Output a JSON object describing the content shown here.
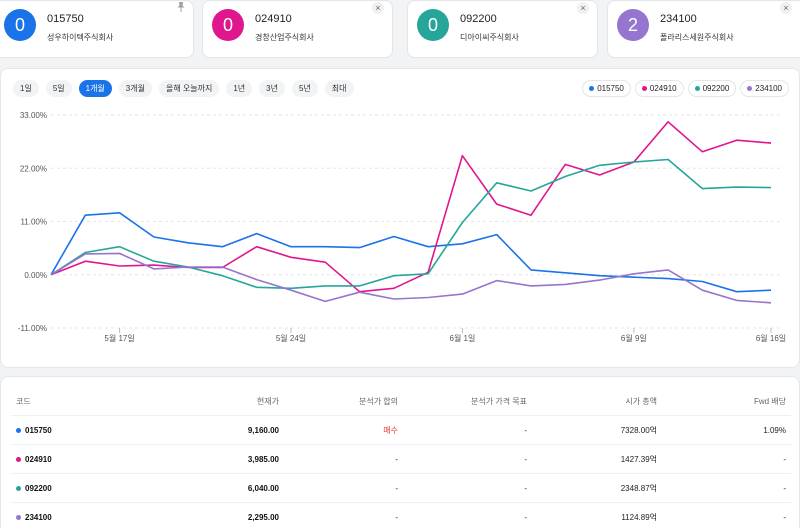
{
  "stocks": [
    {
      "index": "0",
      "code": "015750",
      "name": "성우하이텍주식회사",
      "color": "#1a73e8",
      "corner_icon": "pin-icon"
    },
    {
      "index": "0",
      "code": "024910",
      "name": "경창산업주식회사",
      "color": "#e0168f",
      "corner_icon": "close-icon"
    },
    {
      "index": "0",
      "code": "092200",
      "name": "디아이씨주식회사",
      "color": "#26a69a",
      "corner_icon": "close-icon"
    },
    {
      "index": "2",
      "code": "234100",
      "name": "폴라리스세원주식회사",
      "color": "#9575cd",
      "corner_icon": "close-icon"
    }
  ],
  "close_glyph": "×",
  "ranges": [
    "1일",
    "5일",
    "1개월",
    "3개월",
    "올해 오늘까지",
    "1년",
    "3년",
    "5년",
    "최대"
  ],
  "active_range": "1개월",
  "chart_data": {
    "type": "line",
    "y_ticks": [
      "33.00%",
      "22.00%",
      "11.00%",
      "0.00%",
      "-11.00%"
    ],
    "ylim": [
      -11,
      33
    ],
    "x_ticks": [
      {
        "label": "5월 17일",
        "index": 2
      },
      {
        "label": "5월 24일",
        "index": 7
      },
      {
        "label": "6월 1일",
        "index": 12
      },
      {
        "label": "6월 9일",
        "index": 17
      },
      {
        "label": "6월 16일",
        "index": 21
      }
    ],
    "n_points": 22,
    "series": [
      {
        "name": "015750",
        "color": "#1a73e8",
        "values": [
          0,
          12.3,
          12.8,
          7.8,
          6.6,
          5.8,
          8.5,
          5.8,
          5.8,
          5.6,
          7.9,
          5.8,
          6.4,
          8.3,
          1.0,
          0.4,
          -0.2,
          -0.5,
          -0.8,
          -1.4,
          -3.5,
          -3.2
        ]
      },
      {
        "name": "024910",
        "color": "#e0168f",
        "values": [
          0,
          2.8,
          1.8,
          2.0,
          1.5,
          1.5,
          5.8,
          3.6,
          2.6,
          -3.5,
          -2.8,
          0.5,
          24.6,
          14.6,
          12.3,
          22.8,
          20.6,
          23.3,
          31.6,
          25.4,
          27.8,
          27.2
        ]
      },
      {
        "name": "092200",
        "color": "#26a69a",
        "values": [
          0,
          4.6,
          5.8,
          2.8,
          1.6,
          -0.2,
          -2.6,
          -2.8,
          -2.3,
          -2.3,
          -0.2,
          0.2,
          10.8,
          19.0,
          17.3,
          20.3,
          22.6,
          23.3,
          23.8,
          17.8,
          18.1,
          18.0
        ]
      },
      {
        "name": "234100",
        "color": "#9575cd",
        "values": [
          0,
          4.3,
          4.4,
          1.2,
          1.6,
          1.6,
          -1.0,
          -3.2,
          -5.5,
          -3.6,
          -5.0,
          -4.7,
          -4.0,
          -1.2,
          -2.3,
          -2.0,
          -1.1,
          0.2,
          1.0,
          -3.2,
          -5.3,
          -5.8
        ]
      }
    ]
  },
  "table": {
    "headers": [
      "코드",
      "현재가",
      "분석가 합의",
      "분석가 가격 목표",
      "시가 총액",
      "Fwd 배당"
    ],
    "rows": [
      {
        "code": "015750",
        "color": "#1a73e8",
        "price": "9,160.00",
        "consensus": "매수",
        "target": "-",
        "cap": "7328.00억",
        "fwd": "1.09%"
      },
      {
        "code": "024910",
        "color": "#e0168f",
        "price": "3,985.00",
        "consensus": "-",
        "target": "-",
        "cap": "1427.39억",
        "fwd": "-"
      },
      {
        "code": "092200",
        "color": "#26a69a",
        "price": "6,040.00",
        "consensus": "-",
        "target": "-",
        "cap": "2348.87억",
        "fwd": "-"
      },
      {
        "code": "234100",
        "color": "#9575cd",
        "price": "2,295.00",
        "consensus": "-",
        "target": "-",
        "cap": "1124.89억",
        "fwd": "-"
      }
    ]
  }
}
